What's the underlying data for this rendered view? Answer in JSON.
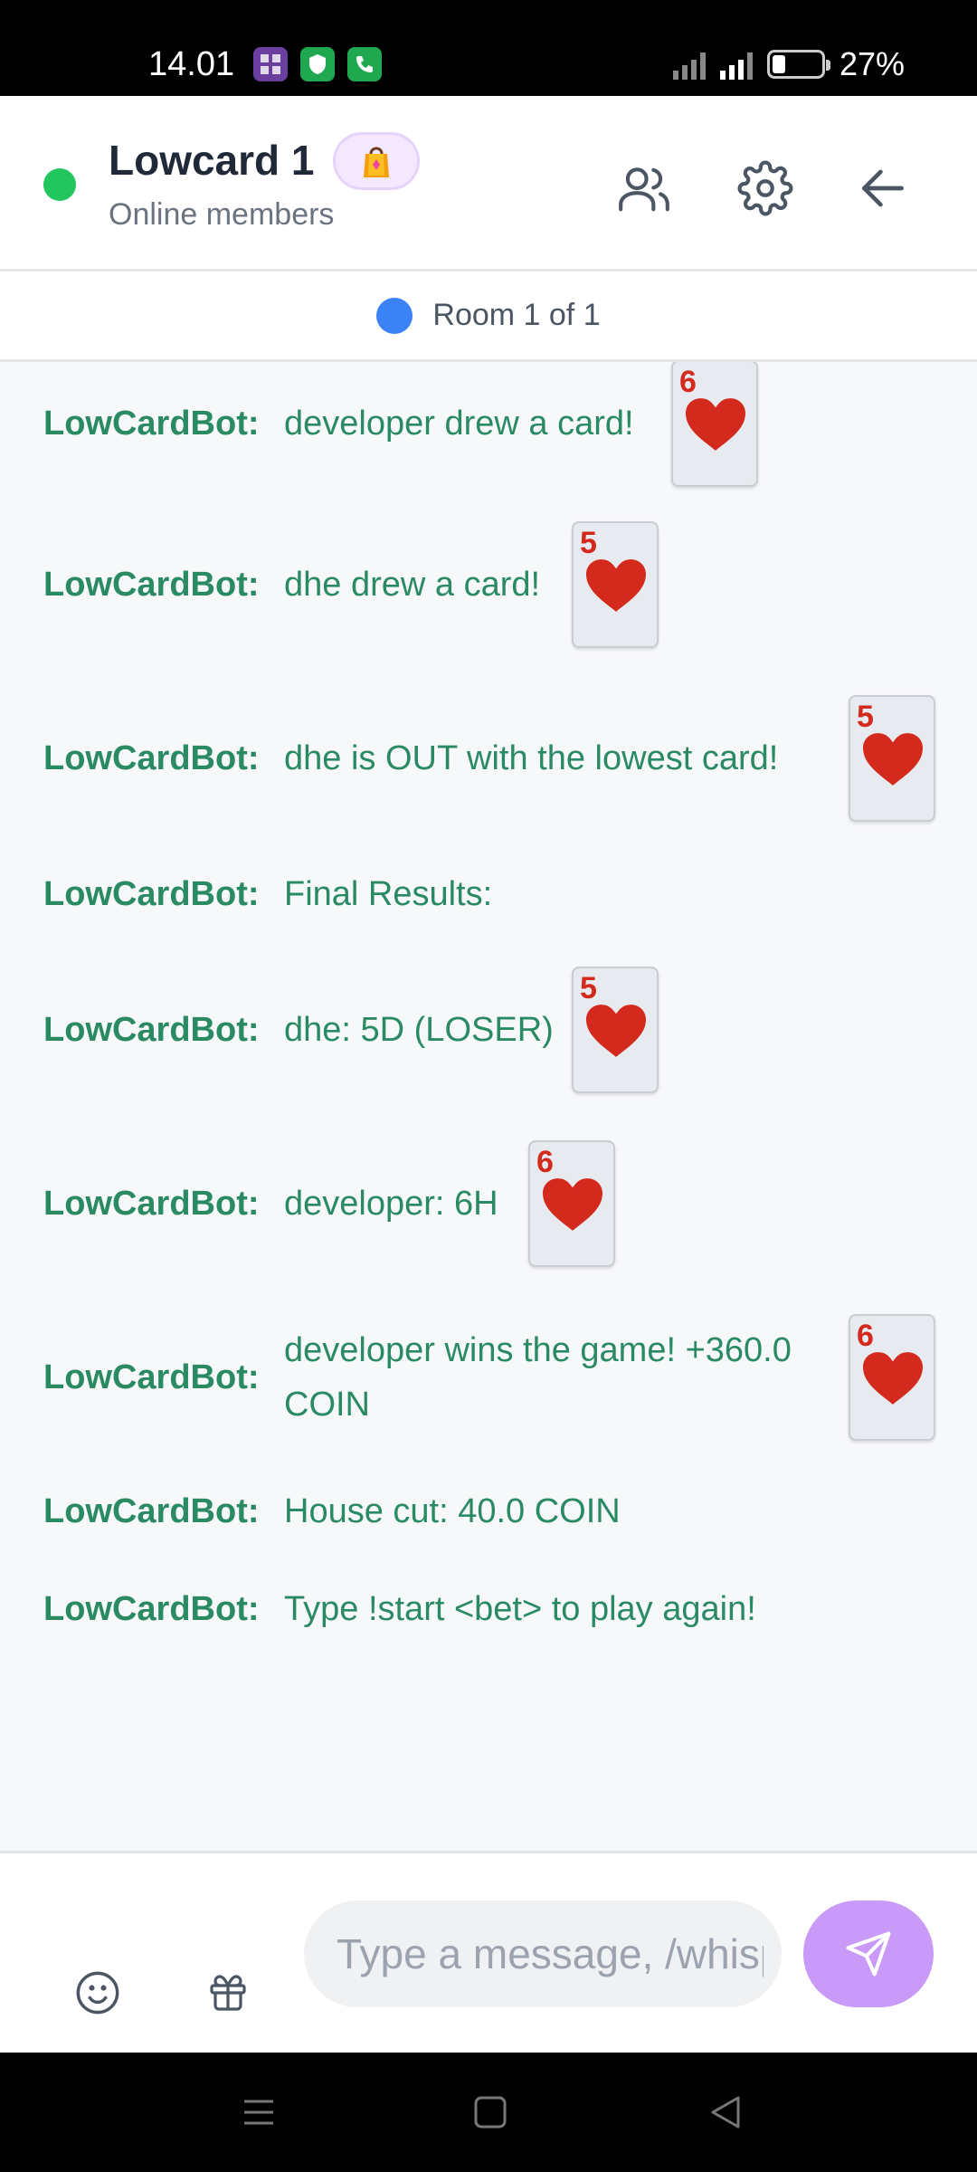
{
  "status_bar": {
    "time": "14.01",
    "battery_percent_label": "27%",
    "battery_level": 0.27,
    "network": "4G",
    "app_icons": [
      "grid-app-icon",
      "shield-app-icon",
      "phone-app-icon"
    ]
  },
  "header": {
    "title": "Lowcard 1",
    "subtitle": "Online members",
    "status_color": "#22c55e",
    "badge_icon": "shopping-bag-icon",
    "actions": [
      "members-icon",
      "settings-icon",
      "back-arrow-icon"
    ]
  },
  "room_bar": {
    "label": "Room 1 of 1",
    "dot_color": "#3b82f6"
  },
  "messages": [
    {
      "sender": "LowCardBot:",
      "text": "developer drew a card!",
      "card": {
        "rank": "6",
        "suit": "heart"
      }
    },
    {
      "sender": "LowCardBot:",
      "text": "dhe drew a card!",
      "card": {
        "rank": "5",
        "suit": "heart"
      }
    },
    {
      "sender": "LowCardBot:",
      "text": "dhe is OUT with the lowest card!",
      "card": {
        "rank": "5",
        "suit": "heart"
      }
    },
    {
      "sender": "LowCardBot:",
      "text": "Final Results:"
    },
    {
      "sender": "LowCardBot:",
      "text": "dhe: 5D (LOSER)",
      "card": {
        "rank": "5",
        "suit": "heart"
      }
    },
    {
      "sender": "LowCardBot:",
      "text": "developer: 6H",
      "card": {
        "rank": "6",
        "suit": "heart"
      }
    },
    {
      "sender": "LowCardBot:",
      "text": "developer wins the game! +360.0 COIN",
      "card": {
        "rank": "6",
        "suit": "heart"
      }
    },
    {
      "sender": "LowCardBot:",
      "text": "House cut: 40.0 COIN"
    },
    {
      "sender": "LowCardBot:",
      "text": "Type !start <bet> to play again!"
    }
  ],
  "input_bar": {
    "placeholder": "Type a message, /whisper",
    "value": "",
    "emoji_icon": "emoji-icon",
    "gift_icon": "gift-icon",
    "send_icon": "send-icon",
    "send_color": "#c99af7"
  },
  "nav_bar": {
    "buttons": [
      "menu-nav-icon",
      "home-nav-icon",
      "back-nav-icon"
    ]
  },
  "colors": {
    "bot_text": "#2a8a63",
    "card_red": "#d42a1e"
  }
}
